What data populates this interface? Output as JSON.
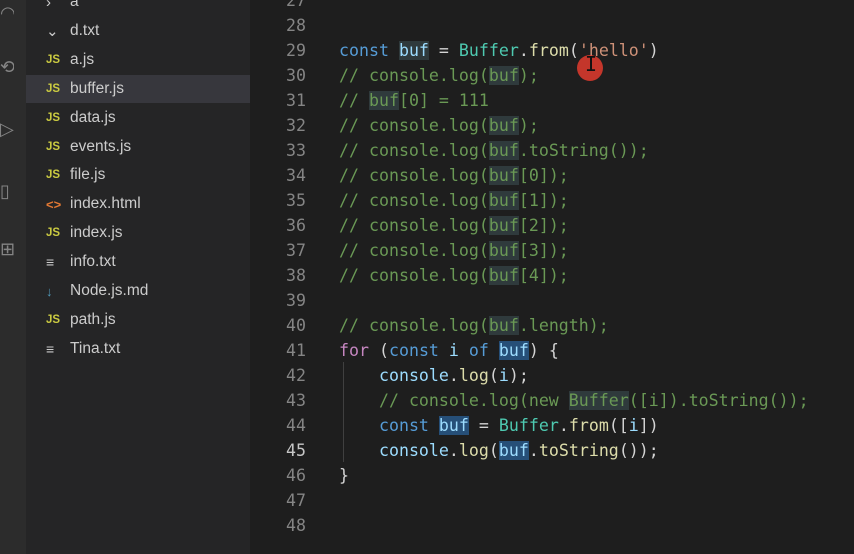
{
  "activity_bar": {
    "icons": [
      "source-control-icon",
      "run-debug-icon",
      "extensions-icon",
      "remote-icon",
      "settings-icon"
    ]
  },
  "explorer": {
    "items": [
      {
        "label": "a",
        "icon": "chevron-right-icon",
        "glyph": "›",
        "type": "chev"
      },
      {
        "label": "d.txt",
        "icon": "chevron-down-icon",
        "glyph": "⌄",
        "type": "chev"
      },
      {
        "label": "a.js",
        "icon": "js-file-icon",
        "glyph": "JS",
        "type": "js"
      },
      {
        "label": "buffer.js",
        "icon": "js-file-icon",
        "glyph": "JS",
        "type": "js",
        "selected": true
      },
      {
        "label": "data.js",
        "icon": "js-file-icon",
        "glyph": "JS",
        "type": "js"
      },
      {
        "label": "events.js",
        "icon": "js-file-icon",
        "glyph": "JS",
        "type": "js"
      },
      {
        "label": "file.js",
        "icon": "js-file-icon",
        "glyph": "JS",
        "type": "js"
      },
      {
        "label": "index.html",
        "icon": "html-file-icon",
        "glyph": "<>",
        "type": "html"
      },
      {
        "label": "index.js",
        "icon": "js-file-icon",
        "glyph": "JS",
        "type": "js"
      },
      {
        "label": "info.txt",
        "icon": "text-file-icon",
        "glyph": "≡",
        "type": "txt"
      },
      {
        "label": "Node.js.md",
        "icon": "markdown-file-icon",
        "glyph": "↓",
        "type": "md"
      },
      {
        "label": "path.js",
        "icon": "js-file-icon",
        "glyph": "JS",
        "type": "js"
      },
      {
        "label": "Tina.txt",
        "icon": "text-file-icon",
        "glyph": "≡",
        "type": "txt"
      }
    ]
  },
  "editor": {
    "current_line": 45,
    "lines": [
      {
        "n": "27",
        "t": []
      },
      {
        "n": "28",
        "t": []
      },
      {
        "n": "29",
        "t": [
          [
            "kw",
            "const"
          ],
          [
            "",
            " "
          ],
          [
            "var hl-weak",
            "buf"
          ],
          [
            "",
            " = "
          ],
          [
            "cls",
            "Buffer"
          ],
          [
            "",
            "."
          ],
          [
            "fn",
            "from"
          ],
          [
            "",
            "("
          ],
          [
            "str",
            "'hello'"
          ],
          [
            "",
            ")"
          ]
        ]
      },
      {
        "n": "30",
        "t": [
          [
            "cmt",
            "// console.log("
          ],
          [
            "cmt hl-weak",
            "buf"
          ],
          [
            "cmt",
            ");"
          ]
        ]
      },
      {
        "n": "31",
        "t": [
          [
            "cmt",
            "// "
          ],
          [
            "cmt hl-weak",
            "buf"
          ],
          [
            "cmt",
            "[0] = 111"
          ]
        ]
      },
      {
        "n": "32",
        "t": [
          [
            "cmt",
            "// console.log("
          ],
          [
            "cmt hl-weak",
            "buf"
          ],
          [
            "cmt",
            ");"
          ]
        ]
      },
      {
        "n": "33",
        "t": [
          [
            "cmt",
            "// console.log("
          ],
          [
            "cmt hl-weak",
            "buf"
          ],
          [
            "cmt",
            ".toString());"
          ]
        ]
      },
      {
        "n": "34",
        "t": [
          [
            "cmt",
            "// console.log("
          ],
          [
            "cmt hl-weak",
            "buf"
          ],
          [
            "cmt",
            "[0]);"
          ]
        ]
      },
      {
        "n": "35",
        "t": [
          [
            "cmt",
            "// console.log("
          ],
          [
            "cmt hl-weak",
            "buf"
          ],
          [
            "cmt",
            "[1]);"
          ]
        ]
      },
      {
        "n": "36",
        "t": [
          [
            "cmt",
            "// console.log("
          ],
          [
            "cmt hl-weak",
            "buf"
          ],
          [
            "cmt",
            "[2]);"
          ]
        ]
      },
      {
        "n": "37",
        "t": [
          [
            "cmt",
            "// console.log("
          ],
          [
            "cmt hl-weak",
            "buf"
          ],
          [
            "cmt",
            "[3]);"
          ]
        ]
      },
      {
        "n": "38",
        "t": [
          [
            "cmt",
            "// console.log("
          ],
          [
            "cmt hl-weak",
            "buf"
          ],
          [
            "cmt",
            "[4]);"
          ]
        ]
      },
      {
        "n": "39",
        "t": []
      },
      {
        "n": "40",
        "t": [
          [
            "cmt",
            "// console.log("
          ],
          [
            "cmt hl-weak",
            "buf"
          ],
          [
            "cmt",
            ".length);"
          ]
        ]
      },
      {
        "n": "41",
        "t": [
          [
            "kw2",
            "for"
          ],
          [
            "",
            " ("
          ],
          [
            "kw",
            "const"
          ],
          [
            "",
            " "
          ],
          [
            "var",
            "i"
          ],
          [
            "",
            " "
          ],
          [
            "kw",
            "of"
          ],
          [
            "",
            " "
          ],
          [
            "var hl",
            "buf"
          ],
          [
            "",
            ") {"
          ]
        ]
      },
      {
        "n": "42",
        "t": [
          [
            "",
            "    "
          ],
          [
            "var",
            "console"
          ],
          [
            "",
            "."
          ],
          [
            "fn",
            "log"
          ],
          [
            "",
            "("
          ],
          [
            "var",
            "i"
          ],
          [
            "",
            ");"
          ]
        ]
      },
      {
        "n": "43",
        "t": [
          [
            "",
            "    "
          ],
          [
            "cmt",
            "// console.log(new "
          ],
          [
            "cmt hl-weak",
            "Buffer"
          ],
          [
            "cmt",
            "([i]).toString());"
          ]
        ]
      },
      {
        "n": "44",
        "t": [
          [
            "",
            "    "
          ],
          [
            "kw",
            "const"
          ],
          [
            "",
            " "
          ],
          [
            "var hl",
            "buf"
          ],
          [
            "",
            " = "
          ],
          [
            "cls",
            "Buffer"
          ],
          [
            "",
            "."
          ],
          [
            "fn",
            "from"
          ],
          [
            "",
            "(["
          ],
          [
            "var",
            "i"
          ],
          [
            "",
            "])"
          ]
        ]
      },
      {
        "n": "45",
        "t": [
          [
            "",
            "    "
          ],
          [
            "var",
            "console"
          ],
          [
            "",
            "."
          ],
          [
            "fn",
            "log"
          ],
          [
            "",
            "("
          ],
          [
            "var hl",
            "buf"
          ],
          [
            "",
            "."
          ],
          [
            "fn",
            "toString"
          ],
          [
            "",
            "());"
          ]
        ]
      },
      {
        "n": "46",
        "t": [
          [
            "",
            "}"
          ]
        ]
      },
      {
        "n": "47",
        "t": []
      },
      {
        "n": "48",
        "t": []
      }
    ]
  },
  "cursor": {
    "glyph": "I"
  }
}
